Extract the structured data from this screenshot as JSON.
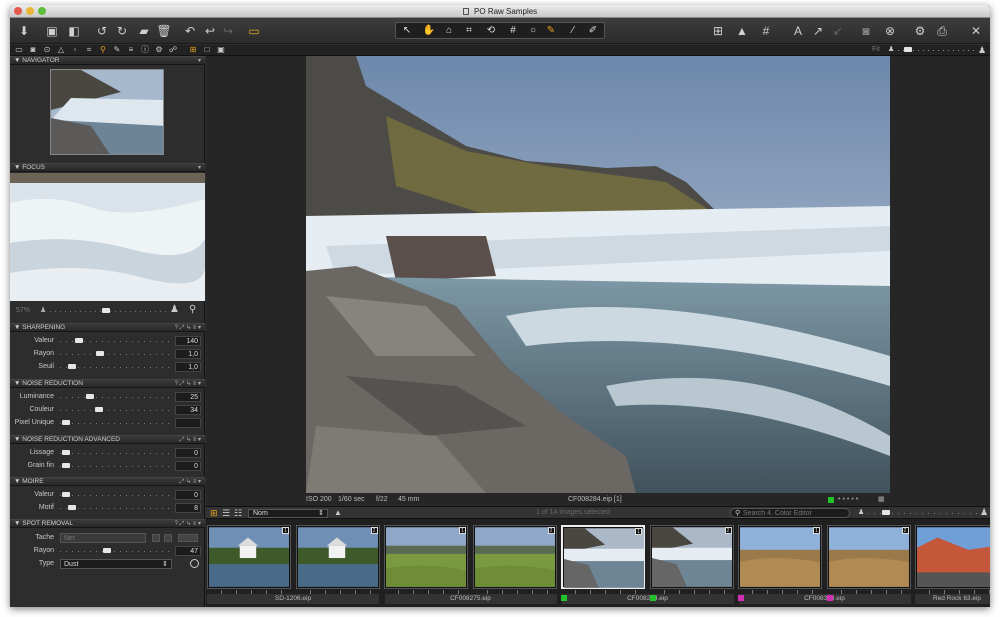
{
  "window": {
    "title": "PO Raw Samples"
  },
  "panels": {
    "navigator": {
      "title": "NAVIGATOR"
    },
    "focus": {
      "title": "FOCUS",
      "zoom": "57%"
    },
    "sharpening": {
      "title": "SHARPENING",
      "rows": [
        {
          "label": "Valeur",
          "value": "140",
          "pos": 0.15
        },
        {
          "label": "Rayon",
          "value": "1,0",
          "pos": 0.35
        },
        {
          "label": "Seuil",
          "value": "1,0",
          "pos": 0.08
        }
      ]
    },
    "noise_reduction": {
      "title": "NOISE REDUCTION",
      "rows": [
        {
          "label": "Luminance",
          "value": "25",
          "pos": 0.25
        },
        {
          "label": "Couleur",
          "value": "34",
          "pos": 0.34
        },
        {
          "label": "Pixel Unique",
          "value": "",
          "pos": 0.02
        }
      ]
    },
    "noise_reduction_advanced": {
      "title": "NOISE REDUCTION ADVANCED",
      "rows": [
        {
          "label": "Lissage",
          "value": "0",
          "pos": 0.02
        },
        {
          "label": "Grain fin",
          "value": "0",
          "pos": 0.02
        }
      ]
    },
    "moire": {
      "title": "MOIRE",
      "rows": [
        {
          "label": "Valeur",
          "value": "0",
          "pos": 0.02
        },
        {
          "label": "Motif",
          "value": "8",
          "pos": 0.08
        }
      ]
    },
    "spot_removal": {
      "title": "SPOT REMOVAL",
      "tache_label": "Tache",
      "tache_value": "Net",
      "rayon_label": "Rayon",
      "rayon_value": "47",
      "rayon_pos": 0.42,
      "type_label": "Type",
      "type_value": "Dust"
    }
  },
  "subbar": {
    "fit_label": "Fit"
  },
  "image_info": {
    "iso": "ISO 200",
    "shutter": "1/60 sec",
    "aperture": "f/22",
    "focal": "45 mm",
    "filename": "CF008284.eip [1]"
  },
  "browser": {
    "sort_value": "Nom",
    "count_text": "1 of 14 images selected",
    "search_placeholder": "Search 4. Color Editor"
  },
  "filmstrip": [
    {
      "name": "SD-1206.eip",
      "num": "1",
      "type": "house"
    },
    {
      "name": "",
      "num": "2",
      "type": "house"
    },
    {
      "name": "",
      "num": "1",
      "type": "field"
    },
    {
      "name": "CF008275.eip",
      "num": "2",
      "type": "field"
    },
    {
      "name": "",
      "num": "1",
      "type": "water",
      "selected": true
    },
    {
      "name": "CF008284.eip",
      "num": "2",
      "type": "water"
    },
    {
      "name": "",
      "num": "1",
      "type": "desert"
    },
    {
      "name": "CF008339.eip",
      "num": "2",
      "type": "desert"
    },
    {
      "name": "Red Rock 63.eip",
      "num": "1",
      "type": "redrock"
    }
  ],
  "colors": {
    "accent": "#e8a21f",
    "green_tag": "#22c22a",
    "magenta_tag": "#d12fb5"
  }
}
